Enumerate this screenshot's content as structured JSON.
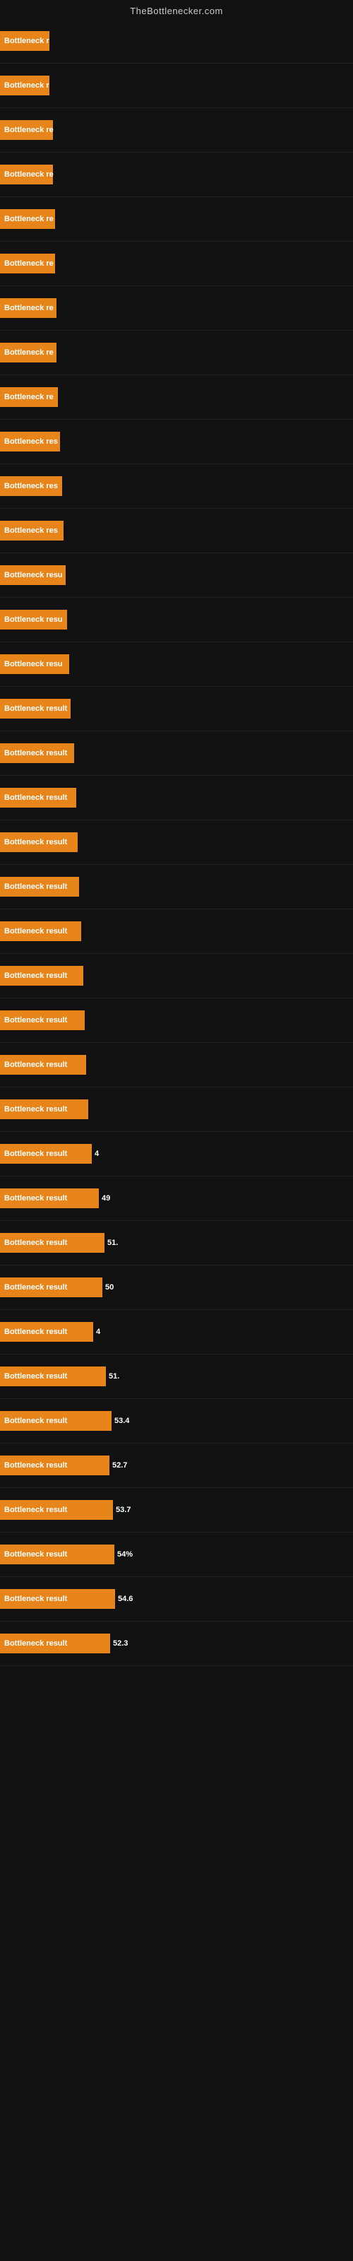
{
  "site": {
    "title": "TheBottlenecker.com"
  },
  "bars": [
    {
      "label": "Bottleneck r",
      "value": null,
      "width": 70
    },
    {
      "label": "Bottleneck r",
      "value": null,
      "width": 70
    },
    {
      "label": "Bottleneck re",
      "value": null,
      "width": 75
    },
    {
      "label": "Bottleneck re",
      "value": null,
      "width": 75
    },
    {
      "label": "Bottleneck re",
      "value": null,
      "width": 78
    },
    {
      "label": "Bottleneck re",
      "value": null,
      "width": 78
    },
    {
      "label": "Bottleneck re",
      "value": null,
      "width": 80
    },
    {
      "label": "Bottleneck re",
      "value": null,
      "width": 80
    },
    {
      "label": "Bottleneck re",
      "value": null,
      "width": 82
    },
    {
      "label": "Bottleneck res",
      "value": null,
      "width": 85
    },
    {
      "label": "Bottleneck res",
      "value": null,
      "width": 88
    },
    {
      "label": "Bottleneck res",
      "value": null,
      "width": 90
    },
    {
      "label": "Bottleneck resu",
      "value": null,
      "width": 93
    },
    {
      "label": "Bottleneck resu",
      "value": null,
      "width": 95
    },
    {
      "label": "Bottleneck resu",
      "value": null,
      "width": 98
    },
    {
      "label": "Bottleneck result",
      "value": null,
      "width": 100
    },
    {
      "label": "Bottleneck result",
      "value": null,
      "width": 105
    },
    {
      "label": "Bottleneck result",
      "value": null,
      "width": 108
    },
    {
      "label": "Bottleneck result",
      "value": null,
      "width": 110
    },
    {
      "label": "Bottleneck result",
      "value": null,
      "width": 112
    },
    {
      "label": "Bottleneck result",
      "value": null,
      "width": 115
    },
    {
      "label": "Bottleneck result",
      "value": null,
      "width": 118
    },
    {
      "label": "Bottleneck result",
      "value": null,
      "width": 120
    },
    {
      "label": "Bottleneck result",
      "value": null,
      "width": 122
    },
    {
      "label": "Bottleneck result",
      "value": null,
      "width": 125
    },
    {
      "label": "Bottleneck result",
      "value": "4",
      "width": 130
    },
    {
      "label": "Bottleneck result",
      "value": "49",
      "width": 140
    },
    {
      "label": "Bottleneck result",
      "value": "51.",
      "width": 148
    },
    {
      "label": "Bottleneck result",
      "value": "50",
      "width": 145
    },
    {
      "label": "Bottleneck result",
      "value": "4",
      "width": 132
    },
    {
      "label": "Bottleneck result",
      "value": "51.",
      "width": 150
    },
    {
      "label": "Bottleneck result",
      "value": "53.4",
      "width": 158
    },
    {
      "label": "Bottleneck result",
      "value": "52.7",
      "width": 155
    },
    {
      "label": "Bottleneck result",
      "value": "53.7",
      "width": 160
    },
    {
      "label": "Bottleneck result",
      "value": "54%",
      "width": 162
    },
    {
      "label": "Bottleneck result",
      "value": "54.6",
      "width": 163
    },
    {
      "label": "Bottleneck result",
      "value": "52.3",
      "width": 156
    }
  ]
}
